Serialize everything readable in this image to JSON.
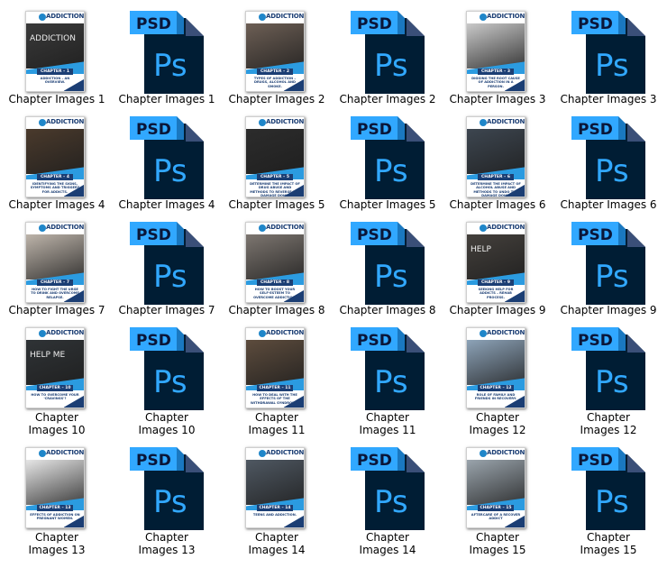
{
  "view": {
    "background": "#ffffff"
  },
  "psd_icon": {
    "tab_text": "PSD",
    "logo_text": "Ps",
    "tab_color": "#31a8ff",
    "body_color": "#001d34",
    "logo_color": "#31a8ff"
  },
  "cover_template": {
    "brand": "ADDICTION",
    "brand_sub": "AUDIO PORTFOLIO",
    "brand_color": "#1b3e74",
    "accent_color": "#2b9be0"
  },
  "files": [
    {
      "type": "jpg",
      "label": "Chapter Images 1",
      "chapter": "CHAPTER – 1",
      "subtitle": "ADDICTION – AN OVERVIEW.",
      "photo_color": "#3a3a3a",
      "photo_text": "ADDICTION"
    },
    {
      "type": "psd",
      "label": "Chapter Images 1"
    },
    {
      "type": "jpg",
      "label": "Chapter Images 2",
      "chapter": "CHAPTER – 2",
      "subtitle": "TYPES OF ADDICTION – DRUGS, ALCOHOL AND SMOKE.",
      "photo_color": "#6d5f55"
    },
    {
      "type": "psd",
      "label": "Chapter Images 2"
    },
    {
      "type": "jpg",
      "label": "Chapter Images 3",
      "chapter": "CHAPTER – 3",
      "subtitle": "DIGGING THE ROOT CAUSE OF ADDICTION IN A PERSON.",
      "photo_color": "#c9c9c9"
    },
    {
      "type": "psd",
      "label": "Chapter Images 3"
    },
    {
      "type": "jpg",
      "label": "Chapter Images 4",
      "chapter": "CHAPTER – 4",
      "subtitle": "IDENTIFYING THE SIGNS, SYMPTOMS AND TRIGGERS FOR ADDICTS.",
      "photo_color": "#4a3a2c"
    },
    {
      "type": "psd",
      "label": "Chapter Images 4"
    },
    {
      "type": "jpg",
      "label": "Chapter Images 5",
      "chapter": "CHAPTER – 5",
      "subtitle": "DETERMINE THE IMPACT OF DRUG ABUSE AND METHODS TO REVERSE THE DAMAGE DONE.",
      "photo_color": "#2c2c2c"
    },
    {
      "type": "psd",
      "label": "Chapter Images 5"
    },
    {
      "type": "jpg",
      "label": "Chapter Images 6",
      "chapter": "CHAPTER – 6",
      "subtitle": "DETERMINE THE IMPACT OF ALCOHOL ABUSE AND METHODS TO UNDO THE DAMAGE DONE.",
      "photo_color": "#3d4650"
    },
    {
      "type": "psd",
      "label": "Chapter Images 6"
    },
    {
      "type": "jpg",
      "label": "Chapter Images 7",
      "chapter": "CHAPTER – 7",
      "subtitle": "HOW TO FIGHT THE URGE TO DRINK AND OVERCOME RELAPSE.",
      "photo_color": "#bdb4aa"
    },
    {
      "type": "psd",
      "label": "Chapter Images 7"
    },
    {
      "type": "jpg",
      "label": "Chapter Images 8",
      "chapter": "CHAPTER – 8",
      "subtitle": "HOW TO BOOST YOUR SELF-ESTEEM TO OVERCOME ADDICTION.",
      "photo_color": "#7d7670"
    },
    {
      "type": "psd",
      "label": "Chapter Images 8"
    },
    {
      "type": "jpg",
      "label": "Chapter Images 9",
      "chapter": "CHAPTER – 9",
      "subtitle": "SEEKING HELP FOR ADDICTS – REHAB PROCESS.",
      "photo_color": "#44403c",
      "photo_text": "HELP"
    },
    {
      "type": "psd",
      "label": "Chapter Images 9"
    },
    {
      "type": "jpg",
      "label": "Chapter Images 10",
      "chapter": "CHAPTER – 10",
      "subtitle": "HOW TO OVERCOME YOUR 'CRAVINGS'?",
      "photo_color": "#2f3336",
      "photo_text": "HELP ME"
    },
    {
      "type": "psd",
      "label": "Chapter Images 10"
    },
    {
      "type": "jpg",
      "label": "Chapter Images 11",
      "chapter": "CHAPTER – 11",
      "subtitle": "HOW TO DEAL WITH THE EFFECTS OF THE WITHDRAWAL SYNDROME?",
      "photo_color": "#5d4c3d"
    },
    {
      "type": "psd",
      "label": "Chapter Images 11"
    },
    {
      "type": "jpg",
      "label": "Chapter Images 12",
      "chapter": "CHAPTER – 12",
      "subtitle": "ROLE OF FAMILY AND FRIENDS IN RECOVERY.",
      "photo_color": "#8da3b8"
    },
    {
      "type": "psd",
      "label": "Chapter Images 12"
    },
    {
      "type": "jpg",
      "label": "Chapter Images 13",
      "chapter": "CHAPTER – 13",
      "subtitle": "EFFECTS OF ADDICTION ON PREGNANT WOMEN.",
      "photo_color": "#e6e6e6"
    },
    {
      "type": "psd",
      "label": "Chapter Images 13"
    },
    {
      "type": "jpg",
      "label": "Chapter Images 14",
      "chapter": "CHAPTER – 14",
      "subtitle": "TEENS AND ADDICTION.",
      "photo_color": "#4f5862"
    },
    {
      "type": "psd",
      "label": "Chapter Images 14"
    },
    {
      "type": "jpg",
      "label": "Chapter Images 15",
      "chapter": "CHAPTER – 15",
      "subtitle": "AFTERCARE OF A RECOVER ADDICT",
      "photo_color": "#9aa4ac"
    },
    {
      "type": "psd",
      "label": "Chapter Images 15"
    }
  ]
}
